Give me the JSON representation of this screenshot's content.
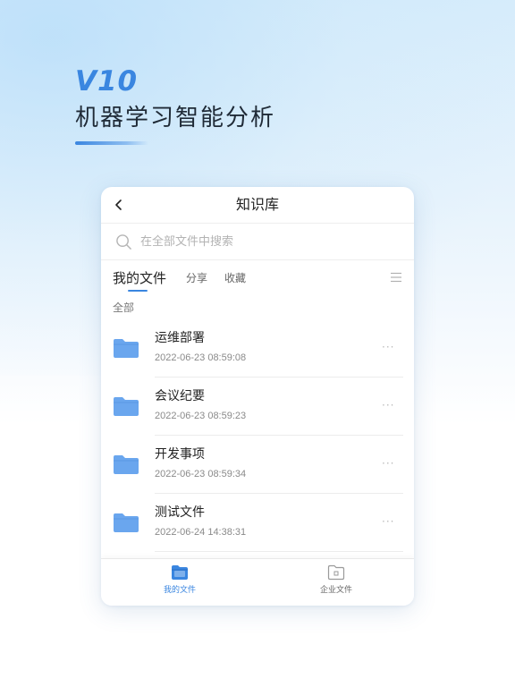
{
  "hero": {
    "version": "V10",
    "title": "机器学习智能分析"
  },
  "app": {
    "title": "知识库",
    "search": {
      "placeholder": "在全部文件中搜索",
      "value": ""
    },
    "tabs": [
      {
        "label": "我的文件",
        "active": true
      },
      {
        "label": "分享",
        "active": false
      },
      {
        "label": "收藏",
        "active": false
      }
    ],
    "section_label": "全部",
    "files": [
      {
        "name": "运维部署",
        "date": "2022-06-23 08:59:08",
        "icon": "folder-icon"
      },
      {
        "name": "会议纪要",
        "date": "2022-06-23 08:59:23",
        "icon": "folder-icon"
      },
      {
        "name": "开发事项",
        "date": "2022-06-23 08:59:34",
        "icon": "folder-icon"
      },
      {
        "name": "测试文件",
        "date": "2022-06-24 14:38:31",
        "icon": "folder-icon"
      }
    ],
    "bottom_nav": [
      {
        "label": "我的文件",
        "icon": "my-files-icon",
        "active": true
      },
      {
        "label": "企业文件",
        "icon": "enterprise-files-icon",
        "active": false
      }
    ]
  },
  "colors": {
    "accent": "#3a86e0",
    "folder": "#6aa6ee",
    "text_primary": "#222222",
    "text_secondary": "#8a8a8a"
  }
}
